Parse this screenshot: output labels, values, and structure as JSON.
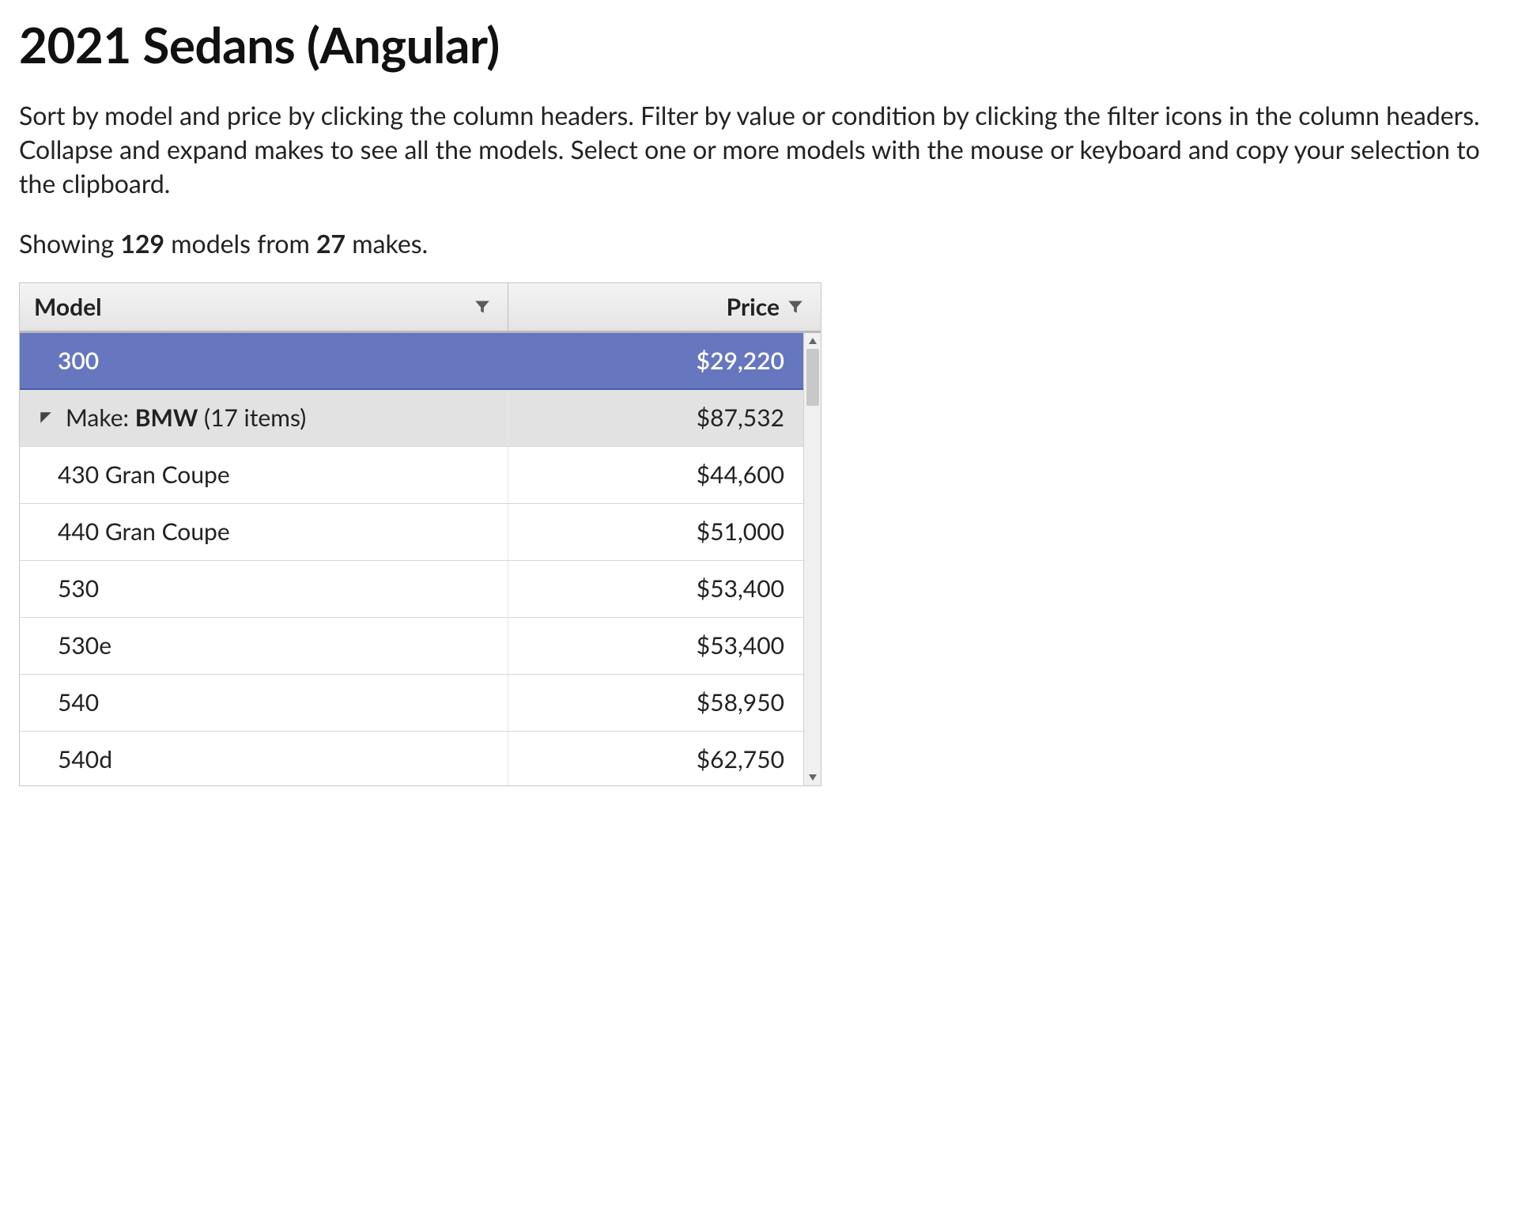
{
  "page": {
    "title": "2021 Sedans (Angular)",
    "description": "Sort by model and price by clicking the column headers. Filter by value or condition by clicking the filter icons in the column headers. Collapse and expand makes to see all the models. Select one or more models with the mouse or keyboard and copy your selection to the clipboard.",
    "summary_prefix": "Showing ",
    "model_count": "129",
    "summary_mid": " models from ",
    "make_count": "27",
    "summary_suffix": " makes."
  },
  "grid": {
    "columns": {
      "model_label": "Model",
      "price_label": "Price"
    },
    "selected_row": {
      "model": "300",
      "price": "$29,220"
    },
    "group": {
      "prefix": "Make: ",
      "name": "BMW",
      "count_text": " (17 items)",
      "aggregate_price": "$87,532"
    },
    "rows": [
      {
        "model": "430 Gran Coupe",
        "price": "$44,600"
      },
      {
        "model": "440 Gran Coupe",
        "price": "$51,000"
      },
      {
        "model": "530",
        "price": "$53,400"
      },
      {
        "model": "530e",
        "price": "$53,400"
      },
      {
        "model": "540",
        "price": "$58,950"
      },
      {
        "model": "540d",
        "price": "$62,750"
      }
    ]
  }
}
